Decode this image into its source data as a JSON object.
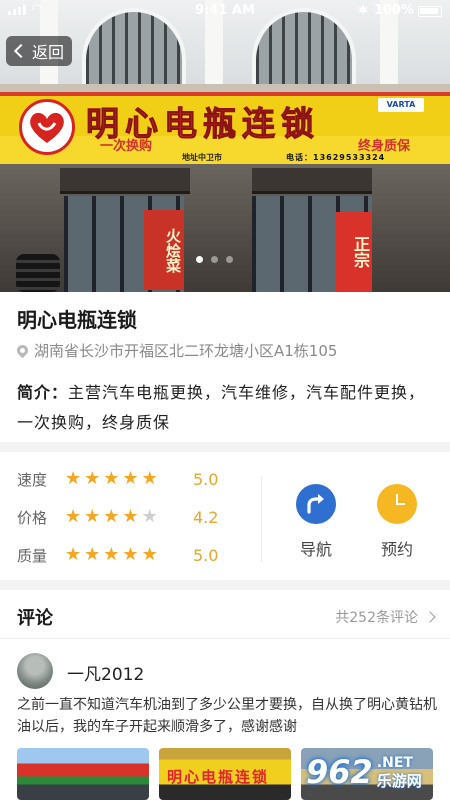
{
  "status_bar": {
    "time": "9:41 AM",
    "battery": "100%"
  },
  "nav": {
    "back_label": "返回"
  },
  "hero": {
    "sign_name": "明心电瓶连锁",
    "sign_slogan_left": "一次换购",
    "sign_slogan_right": "终身质保",
    "sign_address": "地址中卫市",
    "sign_phone": "电话：13629533324",
    "slide_count": 3,
    "active_slide": 1
  },
  "store": {
    "name": "明心电瓶连锁",
    "address": "湖南省长沙市开福区北二环龙塘小区A1栋105",
    "intro_label": "简介：",
    "intro_text": "主营汽车电瓶更换，汽车维修，汽车配件更换，一次换购，终身质保"
  },
  "ratings": [
    {
      "label": "速度",
      "stars": 5,
      "score": "5.0"
    },
    {
      "label": "价格",
      "stars": 4,
      "score": "4.2"
    },
    {
      "label": "质量",
      "stars": 5,
      "score": "5.0"
    }
  ],
  "actions": {
    "navigate": "导航",
    "book": "预约"
  },
  "comments": {
    "title": "评论",
    "total": "共252条评论",
    "items": [
      {
        "user": "一凡2012",
        "text": "之前一直不知道汽车机油到了多少公里才要换，自从换了明心黄钻机油以后，我的车子开起来顺滑多了，感谢感谢"
      }
    ]
  },
  "watermark": {
    "number": "962",
    "en": ".NET",
    "cn": "乐游网"
  },
  "colors": {
    "star": "#f5a623",
    "score": "#e6a72a",
    "navigate": "#2f6fcf",
    "book": "#f6b822"
  }
}
